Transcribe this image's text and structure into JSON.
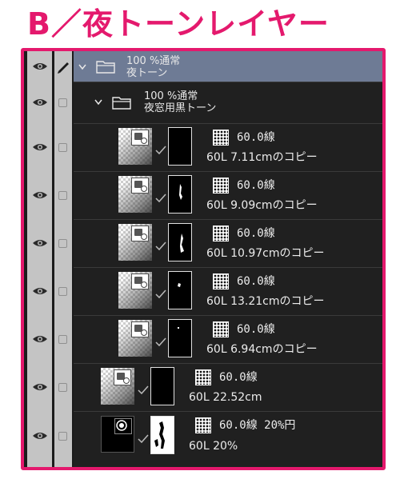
{
  "title": "B／夜トーンレイヤー",
  "icons": {
    "eye": "eye-icon",
    "pen": "pen-icon",
    "lock": "lock-checkbox",
    "folder": "folder-icon",
    "chevron": "chevron-down-icon",
    "link": "link-check-icon",
    "tone": "tone-dots-icon"
  },
  "colors": {
    "accent": "#e4196d",
    "panel": "#202020",
    "selected_folder": "#6e7b95",
    "gutter": "#c4c4c4"
  },
  "folders": [
    {
      "line1": "100 %通常",
      "line2": "夜トーン"
    },
    {
      "line1": "100 %通常",
      "line2": "夜窓用黒トーン"
    }
  ],
  "layers": [
    {
      "tone": "60.0線",
      "name": "60L 7.11cmのコピー"
    },
    {
      "tone": "60.0線",
      "name": "60L 9.09cmのコピー"
    },
    {
      "tone": "60.0線",
      "name": "60L 10.97cmのコピー"
    },
    {
      "tone": "60.0線",
      "name": "60L 13.21cmのコピー"
    },
    {
      "tone": "60.0線",
      "name": "60L 6.94cmのコピー"
    },
    {
      "tone": "60.0線",
      "name": "60L 22.52cm"
    },
    {
      "tone": "60.0線 20%円",
      "name": "60L 20%"
    }
  ]
}
